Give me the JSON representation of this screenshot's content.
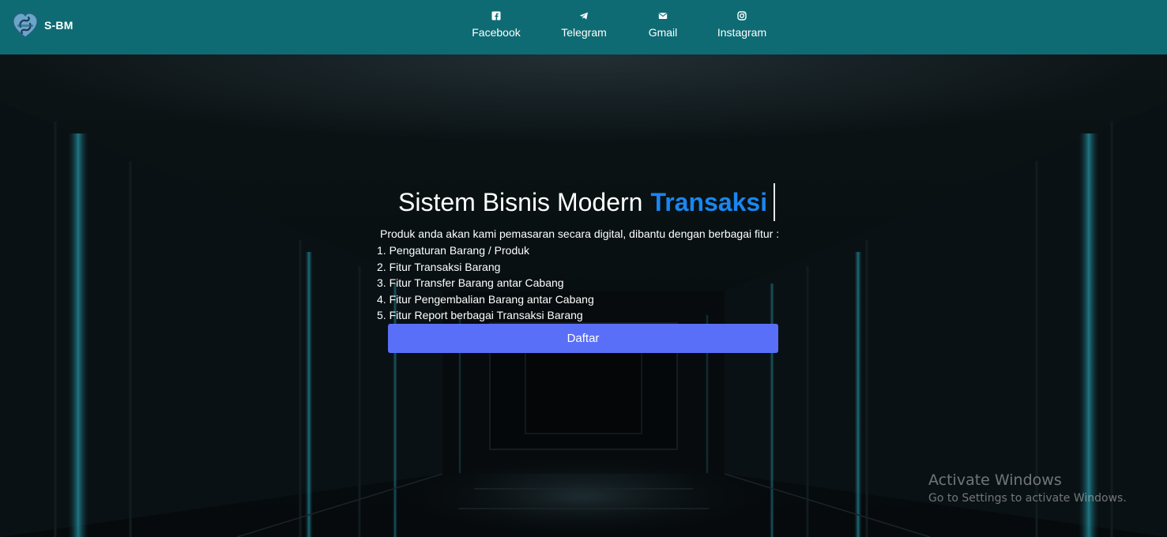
{
  "navbar": {
    "brand": {
      "text": "S-BM",
      "logo_icon": "sbm-logo-icon"
    },
    "links": [
      {
        "label": "Facebook",
        "icon": "facebook-icon"
      },
      {
        "label": "Telegram",
        "icon": "telegram-icon"
      },
      {
        "label": "Gmail",
        "icon": "mail-icon"
      },
      {
        "label": "Instagram",
        "icon": "instagram-icon"
      }
    ]
  },
  "hero": {
    "headline": "Sistem Bisnis Modern",
    "headline_accent": "Transaksi",
    "intro": "Produk anda akan kami pemasaran secara digital, dibantu dengan berbagai fitur :",
    "features": [
      "1. Pengaturan Barang / Produk",
      "2. Fitur Transaksi Barang",
      "3. Fitur Transfer Barang antar Cabang",
      "4. Fitur Pengembalian Barang antar Cabang",
      "5. Fitur Report berbagai Transaksi Barang"
    ],
    "button_label": "Daftar"
  },
  "watermark": {
    "line1": "Activate Windows",
    "line2": "Go to Settings to activate Windows."
  },
  "colors": {
    "navbar": "#0e6b73",
    "accent_text": "#1a86f0",
    "button": "#5a6ff7"
  }
}
